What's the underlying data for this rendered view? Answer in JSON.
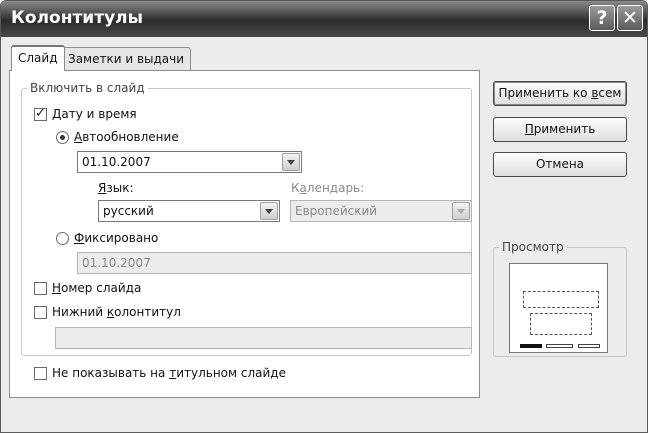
{
  "window": {
    "title": "Колонтитулы"
  },
  "title_buttons": {
    "help": "?",
    "close": "✕"
  },
  "tabs": [
    {
      "label": "Слайд",
      "active": true
    },
    {
      "label": "Заметки и выдачи",
      "active": false
    }
  ],
  "include_group": {
    "legend": "Включить в слайд",
    "date_time": {
      "label_u": "Д",
      "label_rest": "ату и время",
      "checked": true
    },
    "auto_update": {
      "label_u": "А",
      "label_rest": "втообновление",
      "selected": true,
      "value": "01.10.2007"
    },
    "language": {
      "label_u": "Я",
      "label_rest": "зык:",
      "value": "русский"
    },
    "calendar": {
      "label_pre": "К",
      "label_u": "а",
      "label_rest": "лендарь:",
      "value": "Европейский"
    },
    "fixed": {
      "label_u": "Ф",
      "label_rest": "иксировано",
      "selected": false,
      "value": "01.10.2007"
    },
    "slide_number": {
      "label_u": "Н",
      "label_rest": "омер слайда",
      "checked": false
    },
    "footer": {
      "label_pre": "Нижний ",
      "label_u": "к",
      "label_rest": "олонтитул",
      "checked": false,
      "value": ""
    }
  },
  "dont_show_title": {
    "label_pre": "Не показывать на ",
    "label_u": "т",
    "label_rest": "итульном слайде",
    "checked": false
  },
  "buttons": {
    "apply_all": {
      "pre": "Применить ко ",
      "u": "в",
      "rest": "сем"
    },
    "apply": {
      "u": "П",
      "rest": "рименить"
    },
    "cancel": "Отмена"
  },
  "preview": {
    "legend": "Просмотр"
  }
}
